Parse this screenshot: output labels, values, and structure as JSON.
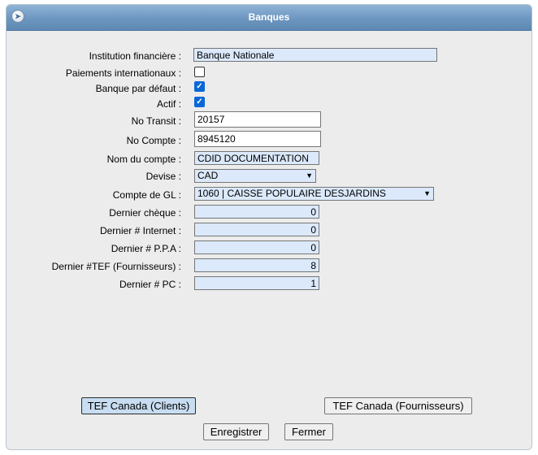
{
  "window": {
    "title": "Banques"
  },
  "form": {
    "institution": {
      "label": "Institution financière :",
      "value": "Banque Nationale"
    },
    "paiements": {
      "label": "Paiements internationaux :",
      "checked": false
    },
    "banque_defaut": {
      "label": "Banque par défaut :",
      "checked": true
    },
    "actif": {
      "label": "Actif :",
      "checked": true
    },
    "no_transit": {
      "label": "No Transit :",
      "value": "20157"
    },
    "no_compte": {
      "label": "No Compte :",
      "value": "8945120"
    },
    "nom_compte": {
      "label": "Nom du compte :",
      "value": "CDID DOCUMENTATION"
    },
    "devise": {
      "label": "Devise :",
      "value": "CAD"
    },
    "compte_gl": {
      "label": "Compte de GL :",
      "value": "1060 | CAISSE POPULAIRE DESJARDINS"
    },
    "dernier_cheque": {
      "label": "Dernier chèque :",
      "value": "0"
    },
    "dernier_internet": {
      "label": "Dernier # Internet :",
      "value": "0"
    },
    "dernier_ppa": {
      "label": "Dernier # P.P.A :",
      "value": "0"
    },
    "dernier_tef": {
      "label": "Dernier #TEF (Fournisseurs) :",
      "value": "8"
    },
    "dernier_pc": {
      "label": "Dernier # PC :",
      "value": "1"
    }
  },
  "buttons": {
    "tef_clients": "TEF Canada (Clients)",
    "tef_fournisseurs": "TEF Canada (Fournisseurs)",
    "enregistrer": "Enregistrer",
    "fermer": "Fermer"
  },
  "colors": {
    "titlebar": "#6d97c1",
    "field_blue": "#dbe9fb",
    "checkbox": "#0a68d6"
  }
}
